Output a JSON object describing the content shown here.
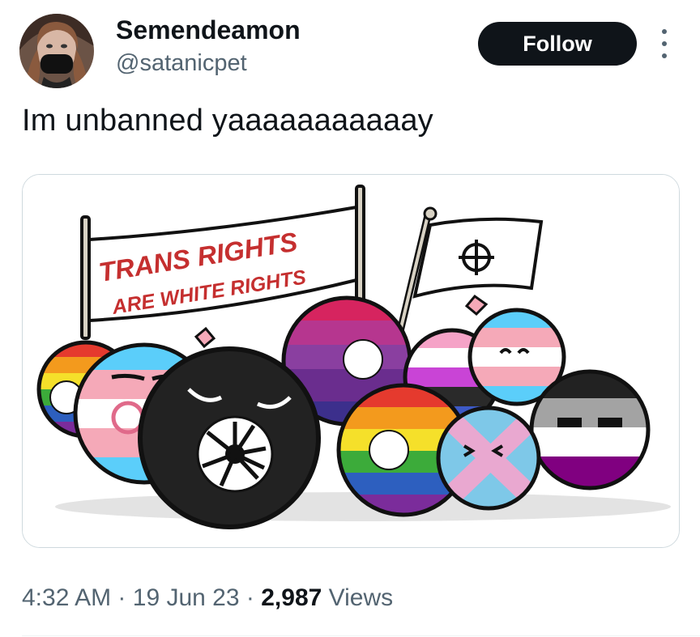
{
  "author": {
    "display_name": "Semendeamon",
    "handle": "@satanicpet"
  },
  "follow_button": {
    "label": "Follow"
  },
  "more_icon": "more-horizontal-icon",
  "tweet": {
    "text": "Im unbanned yaaaaaaaaaaay"
  },
  "media": {
    "banner_line1": "TRANS RIGHTS",
    "banner_line2": "ARE WHITE RIGHTS"
  },
  "meta": {
    "time": "4:32 AM",
    "sep1": "·",
    "date": "19 Jun 23",
    "sep2": "·",
    "views_count": "2,987",
    "views_label": "Views"
  },
  "colors": {
    "follow_bg": "#0f1419",
    "secondary_text": "#536471",
    "card_border": "#cfd9de"
  }
}
